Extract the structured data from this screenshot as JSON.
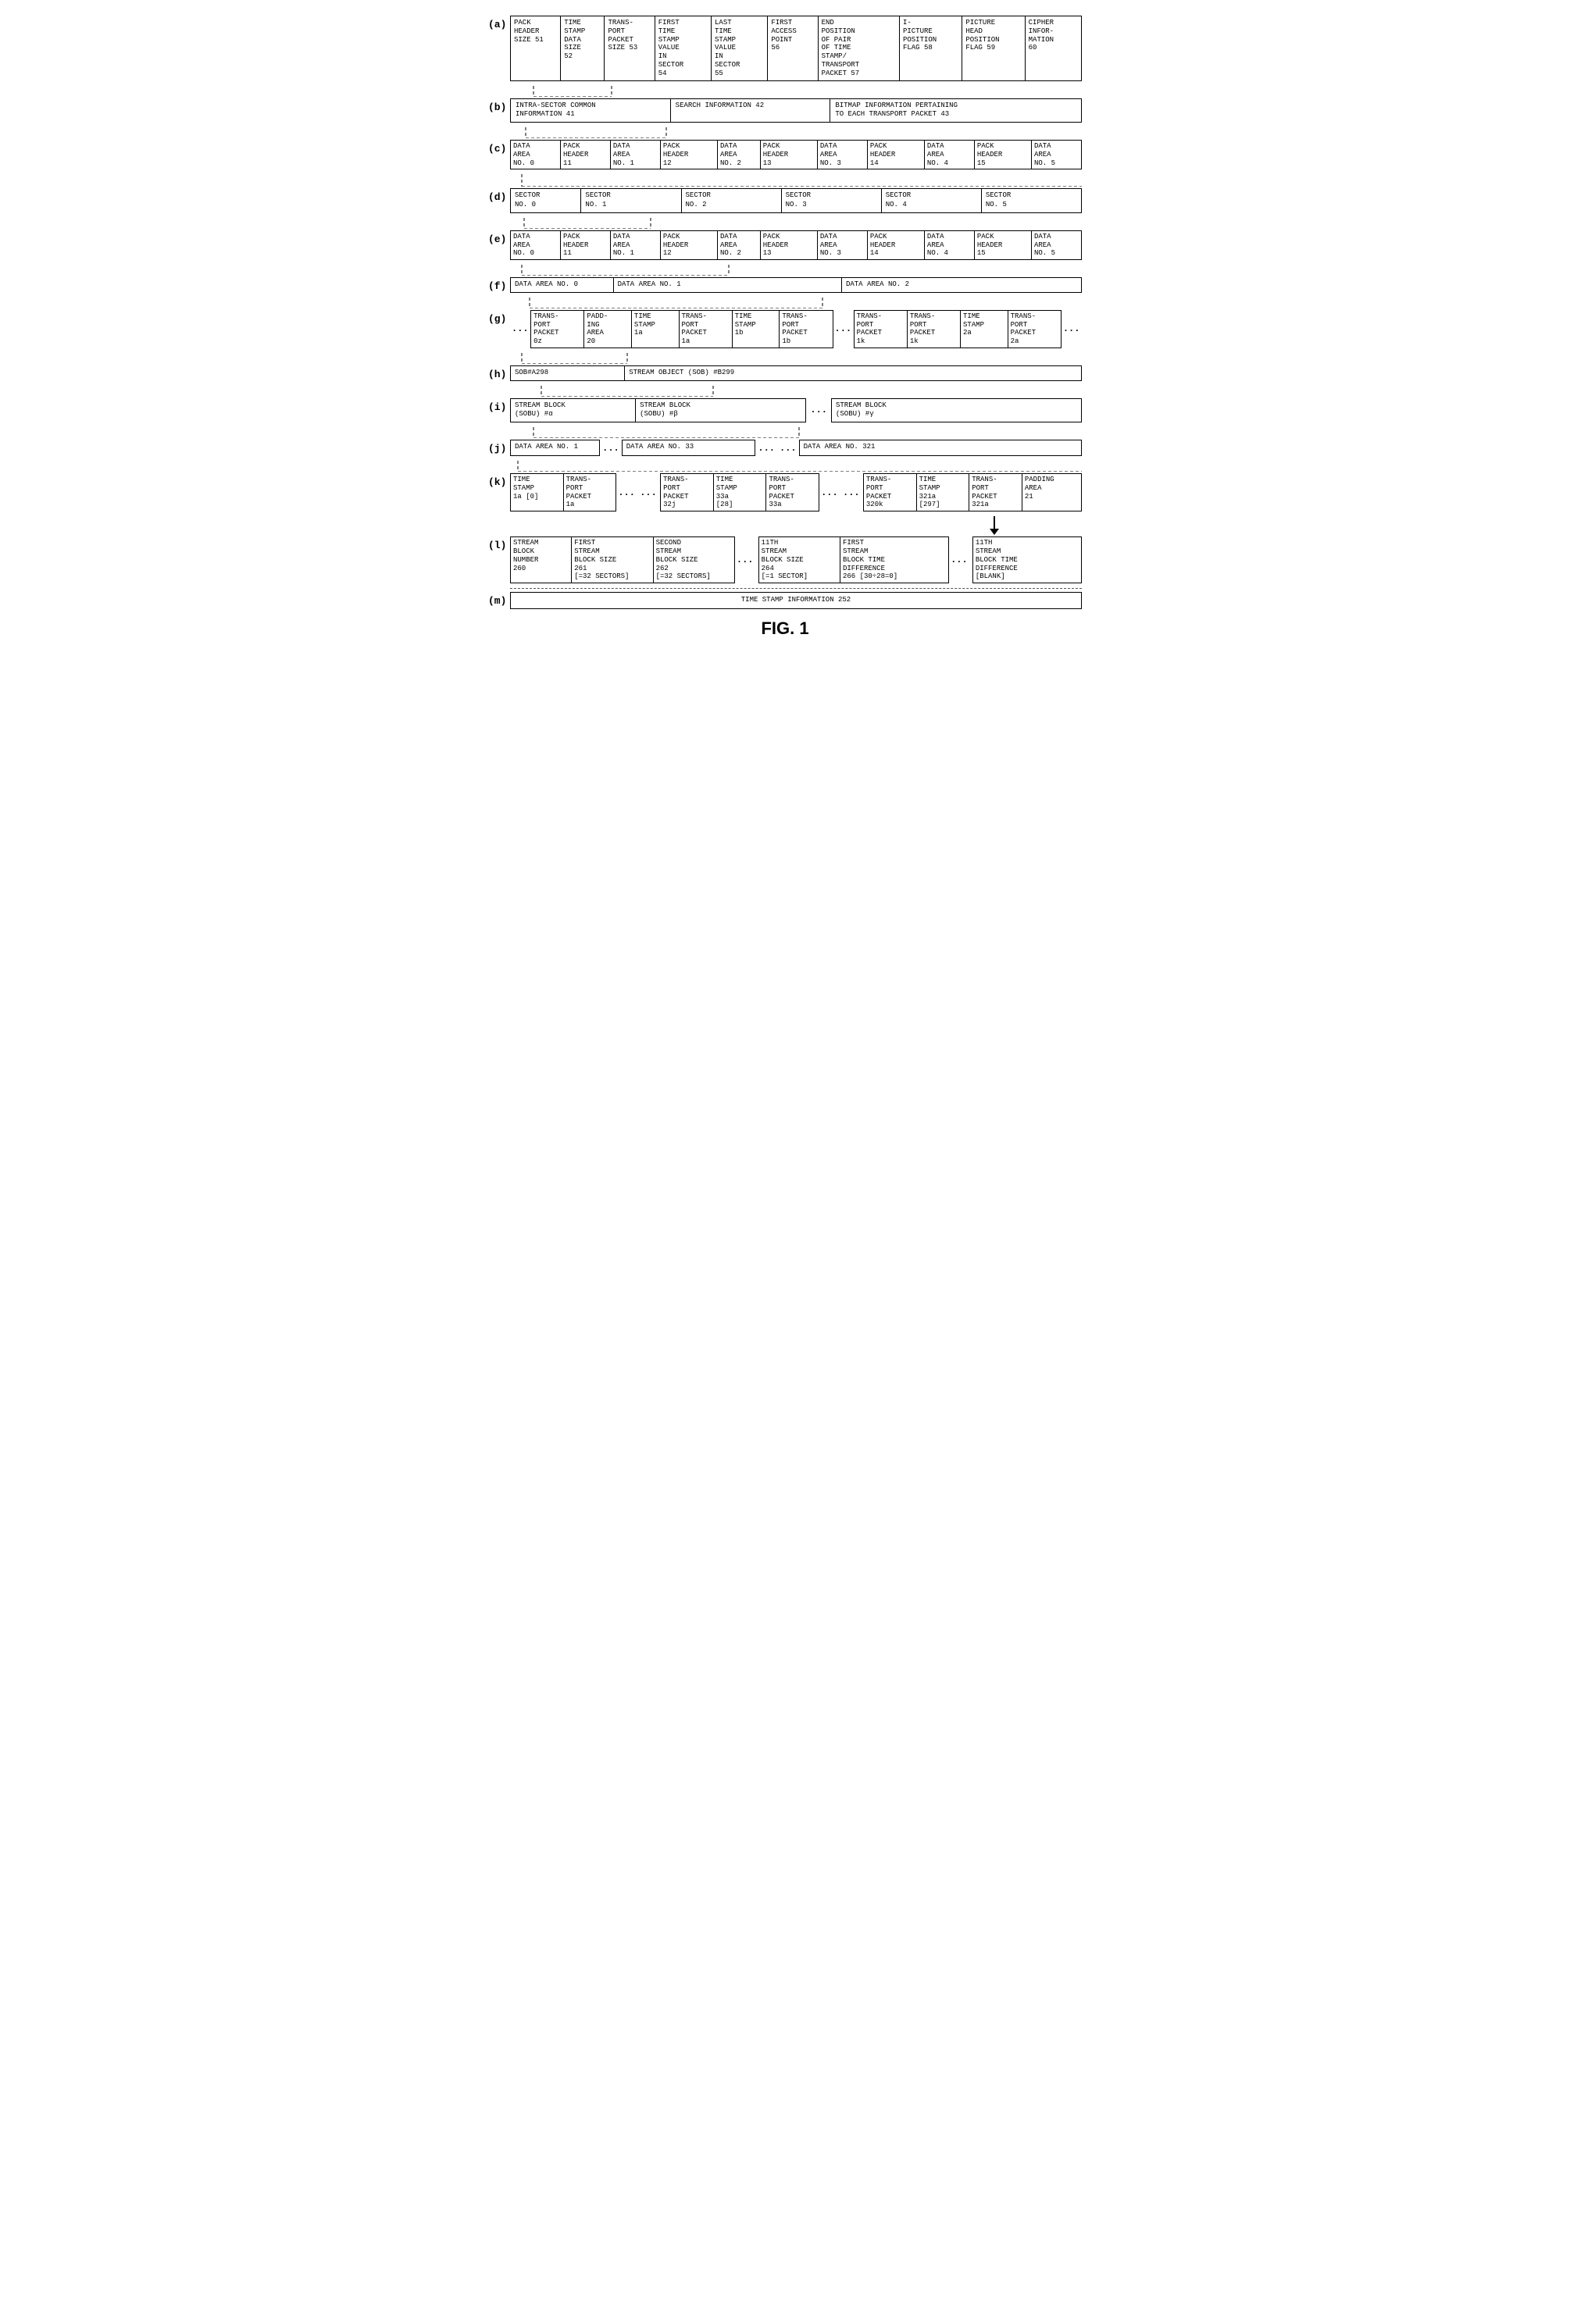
{
  "title": "FIG. 1",
  "rows": {
    "a": {
      "label": "(a)",
      "cells": [
        {
          "text": "PACK\nHEADER\nSIZE 51",
          "width": "7%"
        },
        {
          "text": "TIME\nSTAMP\nDATA\nSIZE\n52",
          "width": "6%"
        },
        {
          "text": "TRANS-\nPORT\nPACKET\nSIZE 53",
          "width": "7%"
        },
        {
          "text": "FIRST\nTIME\nSTAMP\nVALUE\nIN\nSECTOR\n54",
          "width": "8%"
        },
        {
          "text": "LAST\nTIME\nSTAMP\nVALUE\nIN\nSECTOR\n55",
          "width": "8%"
        },
        {
          "text": "FIRST\nACCESS\nPOINT\n56",
          "width": "7%"
        },
        {
          "text": "END\nPOSITION\nOF PAIR\nOF TIME\nSTAMP/\nTRANSPORT\nPACKET 57",
          "width": "12%"
        },
        {
          "text": "I-\nPICTURE\nPOSITION\nFLAG 58",
          "width": "9%"
        },
        {
          "text": "PICTURE\nHEAD\nPOSITION\nFLAG 59",
          "width": "9%"
        },
        {
          "text": "CIPHER\nINFOR-\nMATION\n60",
          "width": "8%"
        }
      ]
    },
    "b": {
      "label": "(b)",
      "cells": [
        {
          "text": "INTRA-SECTOR COMMON\nINFORMATION 41",
          "width": "28%"
        },
        {
          "text": "SEARCH INFORMATION 42",
          "width": "30%"
        },
        {
          "text": "BITMAP INFORMATION PERTAINING\nTO EACH TRANSPORT PACKET 43",
          "width": "42%"
        }
      ]
    },
    "c": {
      "label": "(c)",
      "cells": [
        {
          "text": "DATA\nAREA\nNO. 0",
          "width": "7%"
        },
        {
          "text": "PACK\nHEADER\n11",
          "width": "7%"
        },
        {
          "text": "DATA\nAREA\nNO. 1",
          "width": "7%"
        },
        {
          "text": "PACK\nHEADER\n12",
          "width": "8%"
        },
        {
          "text": "DATA\nAREA\nNO. 2",
          "width": "6%"
        },
        {
          "text": "PACK\nHEADER\n13",
          "width": "8%"
        },
        {
          "text": "DATA\nAREA\nNO. 3",
          "width": "7%"
        },
        {
          "text": "PACK\nHEADER\n14",
          "width": "8%"
        },
        {
          "text": "DATA\nAREA\nNO. 4",
          "width": "7%"
        },
        {
          "text": "PACK\nHEADER\n15",
          "width": "8%"
        },
        {
          "text": "DATA\nAREA\nNO. 5",
          "width": "7%"
        }
      ]
    },
    "d": {
      "label": "(d)",
      "cells": [
        {
          "text": "SECTOR\nNO. 0",
          "width": "12%"
        },
        {
          "text": "SECTOR\nNO. 1",
          "width": "16%"
        },
        {
          "text": "SECTOR\nNO. 2",
          "width": "16%"
        },
        {
          "text": "SECTOR\nNO. 3",
          "width": "16%"
        },
        {
          "text": "SECTOR\nNO. 4",
          "width": "16%"
        },
        {
          "text": "SECTOR\nNO. 5",
          "width": "16%"
        }
      ]
    },
    "e": {
      "label": "(e)",
      "cells": [
        {
          "text": "DATA\nAREA\nNO. 0",
          "width": "7%"
        },
        {
          "text": "PACK\nHEADER\n11",
          "width": "7%"
        },
        {
          "text": "DATA\nAREA\nNO. 1",
          "width": "7%"
        },
        {
          "text": "PACK\nHEADER\n12",
          "width": "8%"
        },
        {
          "text": "DATA\nAREA\nNO. 2",
          "width": "6%"
        },
        {
          "text": "PACK\nHEADER\n13",
          "width": "8%"
        },
        {
          "text": "DATA\nAREA\nNO. 3",
          "width": "7%"
        },
        {
          "text": "PACK\nHEADER\n14",
          "width": "8%"
        },
        {
          "text": "DATA\nAREA\nNO. 4",
          "width": "7%"
        },
        {
          "text": "PACK\nHEADER\n15",
          "width": "8%"
        },
        {
          "text": "DATA\nAREA\nNO. 5",
          "width": "7%"
        }
      ]
    }
  },
  "fig_label": "FIG. 1"
}
